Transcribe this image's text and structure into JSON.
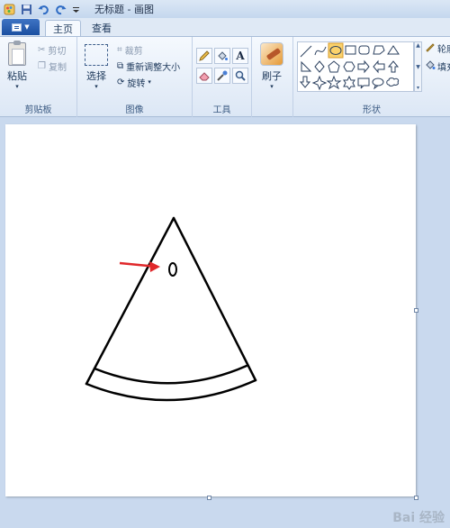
{
  "window": {
    "title": "无标题 - 画图"
  },
  "tabs": {
    "home": "主页",
    "view": "查看"
  },
  "clipboard": {
    "label": "剪贴板",
    "paste": "粘贴",
    "cut": "剪切",
    "copy": "复制"
  },
  "image": {
    "label": "图像",
    "select": "选择",
    "crop": "裁剪",
    "resize": "重新调整大小",
    "rotate": "旋转"
  },
  "tools": {
    "label": "工具"
  },
  "brushes": {
    "label": "刷子"
  },
  "shapes": {
    "label": "形状",
    "outline": "轮廓",
    "fill": "填充"
  },
  "watermark": "Bai 经验",
  "colors": {
    "accent": "#1a4fa0",
    "canvas": "#ffffff",
    "workspace": "#c9d9ee",
    "arrow": "#e0282b",
    "selected_shape": "#fbd26b"
  }
}
